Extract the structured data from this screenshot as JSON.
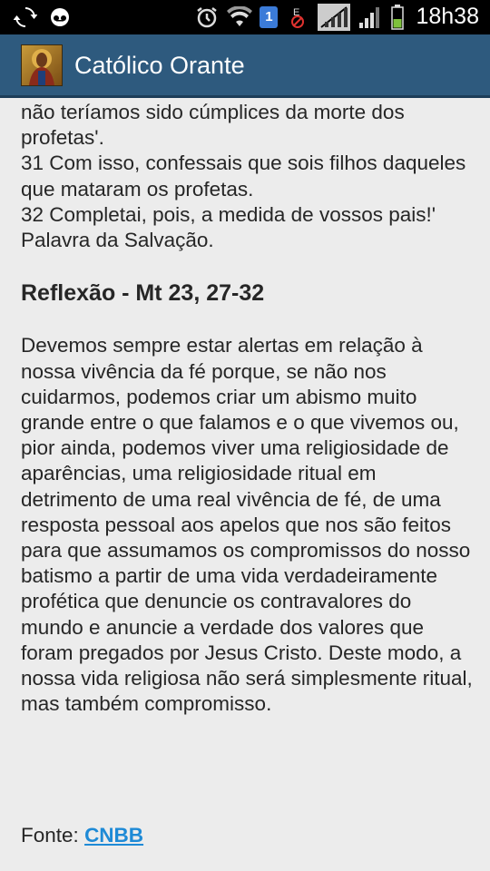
{
  "status": {
    "time": "18h38",
    "sim_number": "1",
    "icons": [
      "sync-icon",
      "voicemail-icon",
      "alarm-icon",
      "wifi-icon",
      "sim-icon",
      "no-data-icon",
      "signal-icon",
      "signal-icon-2",
      "battery-icon"
    ]
  },
  "app": {
    "title": "Católico Orante"
  },
  "reading": {
    "line1": "não teríamos sido cúmplices da morte dos profetas'.",
    "verse31": "31 Com isso, confessais que sois filhos daqueles que mataram os profetas.",
    "verse32": "32 Completai, pois, a medida de vossos pais!'",
    "closing": "Palavra da Salvação."
  },
  "reflection": {
    "heading": "Reflexão - Mt 23, 27-32",
    "text": "Devemos sempre estar alertas em relação à nossa vivência da fé porque, se não nos cuidarmos, podemos criar um abismo muito grande entre o que falamos e o que vivemos ou, pior ainda, podemos viver uma religiosidade de aparências, uma religiosidade ritual em detrimento de uma real vivência de fé, de uma resposta pessoal aos apelos que nos são feitos para que assumamos os compromissos do nosso batismo a partir de uma vida verdadeiramente profética que denuncie os contravalores do mundo e anuncie a verdade dos valores que foram pregados por Jesus Cristo. Deste modo, a nossa vida religiosa não será simplesmente ritual, mas também compromisso."
  },
  "source": {
    "label": "Fonte:",
    "link": "CNBB"
  }
}
